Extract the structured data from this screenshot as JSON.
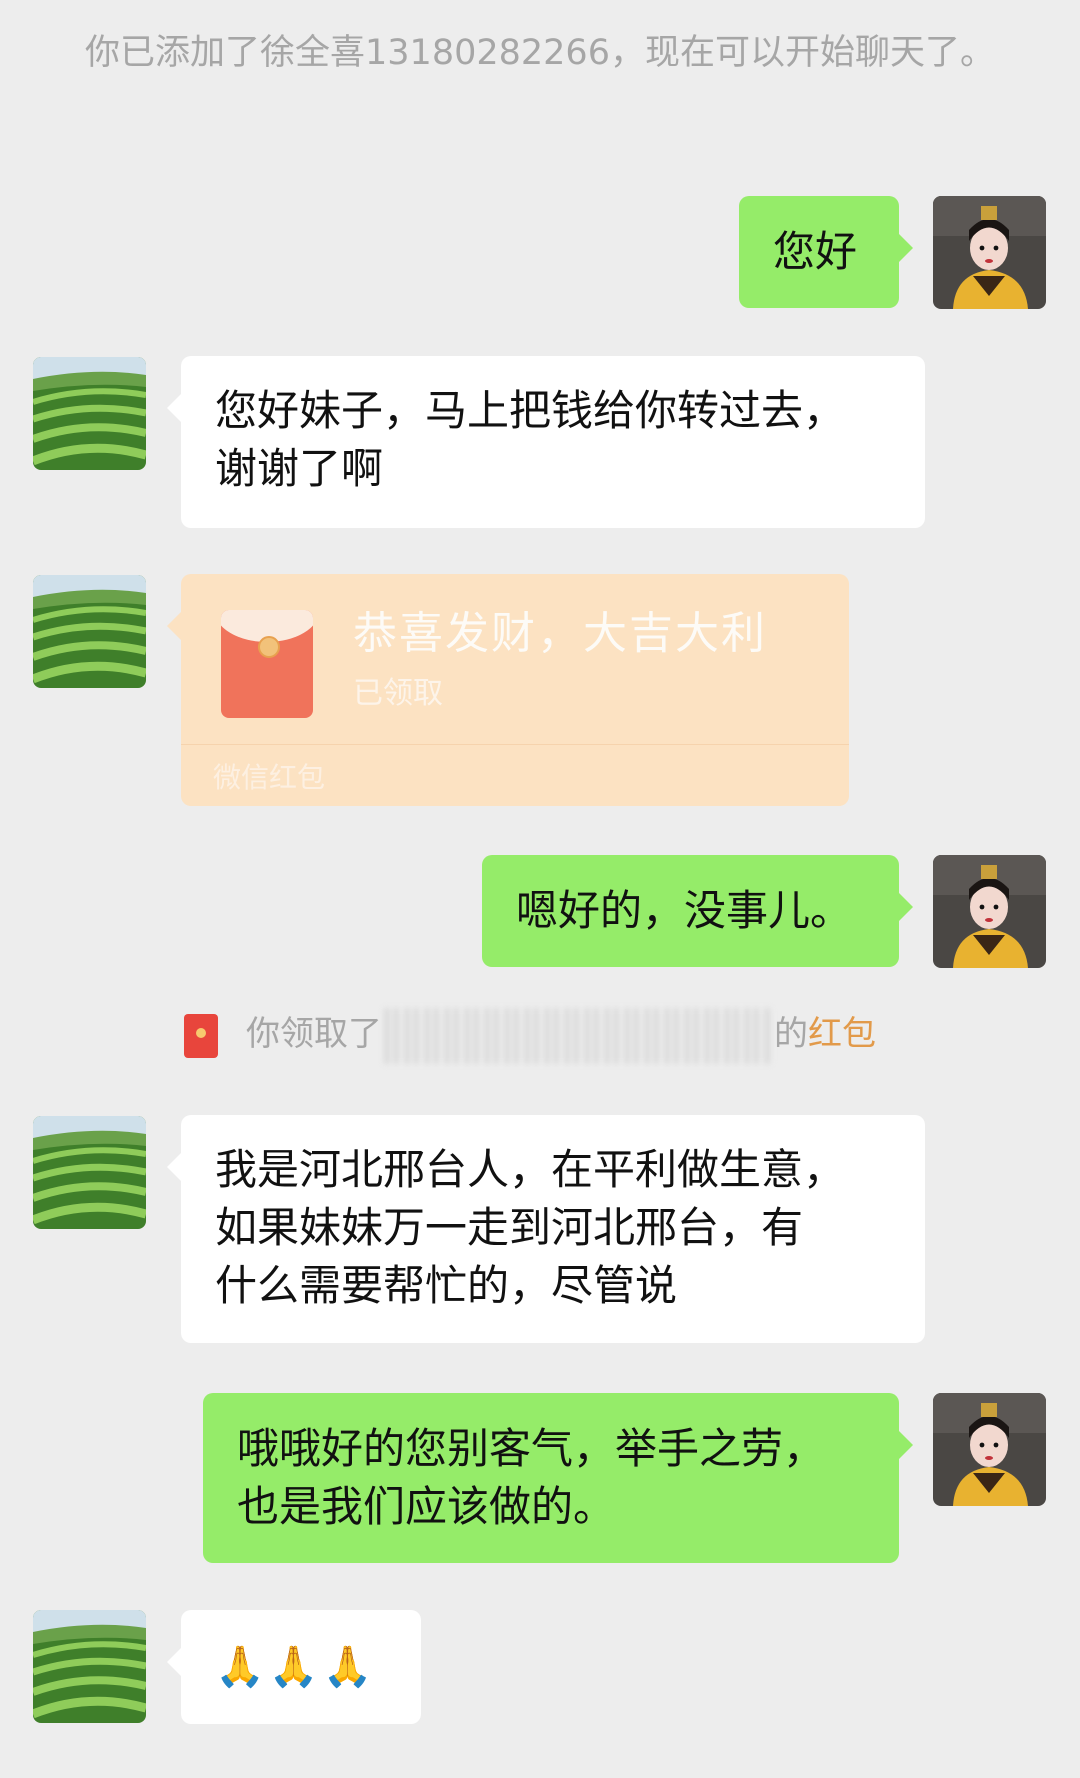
{
  "system_message": "你已添加了徐全喜13180282266，现在可以开始聊天了。",
  "messages": [
    {
      "direction": "out",
      "text": "您好"
    },
    {
      "direction": "in",
      "lines": [
        "您好妹子，马上把钱给你转过去，",
        "谢谢了啊"
      ]
    },
    {
      "direction": "in",
      "type": "red-packet",
      "title": "恭喜发财，大吉大利",
      "status": "已领取",
      "footer": "微信红包"
    },
    {
      "direction": "out",
      "text": "嗯好的，没事儿。"
    },
    {
      "direction": "in",
      "lines": [
        "我是河北邢台人，在平利做生意，",
        "如果妹妹万一走到河北邢台，有",
        "什么需要帮忙的，尽管说"
      ]
    },
    {
      "direction": "out",
      "lines": [
        "哦哦好的您别客气，举手之劳，",
        "也是我们应该做的。"
      ]
    },
    {
      "direction": "in",
      "text": "🙏🙏🙏"
    }
  ],
  "red_packet_notice": {
    "prefix": "你领取了",
    "suffix": "的",
    "link": "红包"
  },
  "colors": {
    "background": "#ededed",
    "incoming_bubble": "#ffffff",
    "outgoing_bubble": "#95ec69",
    "red_packet": "#fce2c2",
    "notice_link": "#e29a4a"
  },
  "icons": {
    "contact_avatar": "tea-field-avatar-icon",
    "self_avatar": "costume-character-avatar-icon",
    "red_packet": "red-envelope-icon"
  }
}
